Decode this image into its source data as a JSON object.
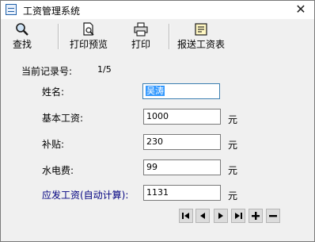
{
  "window": {
    "title": "工资管理系统",
    "close_glyph": "✕"
  },
  "toolbar": {
    "items": [
      {
        "label": "查找",
        "icon": "magnifier-icon"
      },
      {
        "label": "打印预览",
        "icon": "print-preview-icon"
      },
      {
        "label": "打印",
        "icon": "printer-icon"
      },
      {
        "label": "报送工资表",
        "icon": "report-icon"
      }
    ]
  },
  "record": {
    "label": "当前记录号:",
    "value": "1/5"
  },
  "form": {
    "name": {
      "label": "姓名:",
      "value": "吴涛"
    },
    "base_salary": {
      "label": "基本工资:",
      "value": "1000",
      "unit": "元"
    },
    "subsidy": {
      "label": "补贴:",
      "value": "230",
      "unit": "元"
    },
    "utilities": {
      "label": "水电费:",
      "value": "99",
      "unit": "元"
    },
    "payable": {
      "label": "应发工资(自动计算):",
      "value": "1131",
      "unit": "元"
    }
  },
  "navigator": {
    "buttons": [
      {
        "name": "first-record-button",
        "icon": "first-icon"
      },
      {
        "name": "prev-record-button",
        "icon": "prev-icon"
      },
      {
        "name": "next-record-button",
        "icon": "next-icon"
      },
      {
        "name": "last-record-button",
        "icon": "last-icon"
      },
      {
        "name": "add-record-button",
        "icon": "plus-icon"
      },
      {
        "name": "delete-record-button",
        "icon": "minus-icon"
      }
    ]
  },
  "colors": {
    "title_bg": "#ffffff",
    "body_bg": "#f0f0f0",
    "highlight": "#3399ff",
    "label_blue": "#000080"
  }
}
